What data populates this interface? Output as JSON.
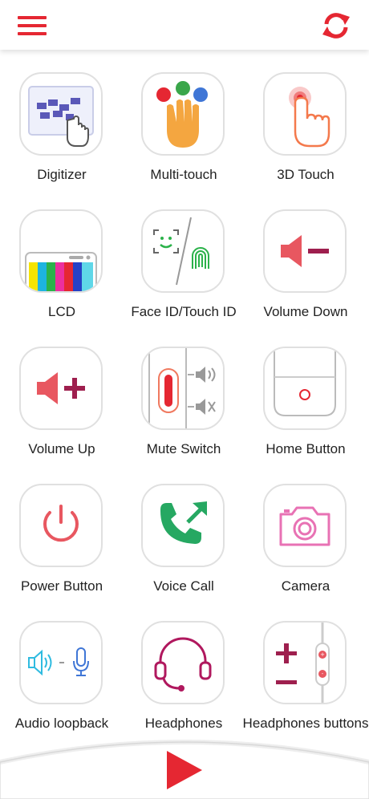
{
  "header": {
    "menu_icon": "hamburger-menu-icon",
    "refresh_icon": "refresh-icon",
    "accent_color": "#e52732"
  },
  "tests": [
    {
      "label": "Digitizer",
      "icon": "digitizer-icon"
    },
    {
      "label": "Multi-touch",
      "icon": "multi-touch-icon"
    },
    {
      "label": "3D Touch",
      "icon": "3d-touch-icon"
    },
    {
      "label": "LCD",
      "icon": "lcd-icon"
    },
    {
      "label": "Face ID/Touch ID",
      "icon": "face-id-touch-id-icon"
    },
    {
      "label": "Volume Down",
      "icon": "volume-down-icon"
    },
    {
      "label": "Volume Up",
      "icon": "volume-up-icon"
    },
    {
      "label": "Mute Switch",
      "icon": "mute-switch-icon"
    },
    {
      "label": "Home Button",
      "icon": "home-button-icon"
    },
    {
      "label": "Power Button",
      "icon": "power-button-icon"
    },
    {
      "label": "Voice Call",
      "icon": "voice-call-icon"
    },
    {
      "label": "Camera",
      "icon": "camera-icon"
    },
    {
      "label": "Audio loopback",
      "icon": "audio-loopback-icon"
    },
    {
      "label": "Headphones",
      "icon": "headphones-icon"
    },
    {
      "label": "Headphones buttons",
      "icon": "headphones-buttons-icon"
    }
  ],
  "footer": {
    "play_icon": "play-icon"
  }
}
